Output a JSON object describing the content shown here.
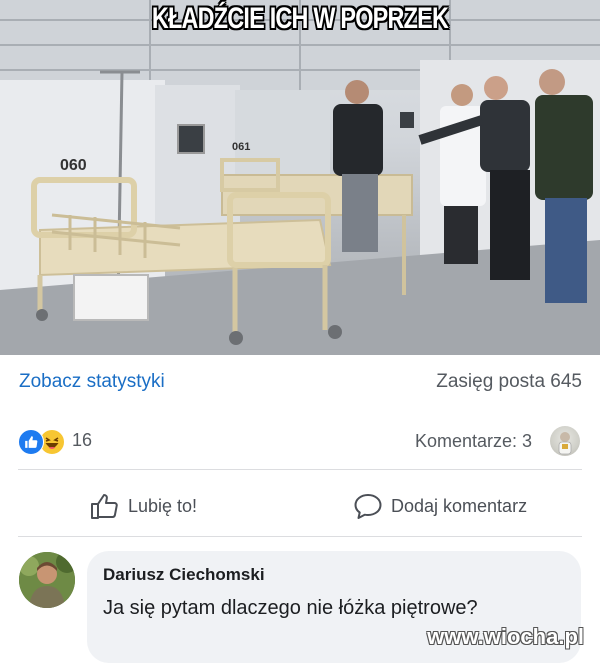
{
  "photo": {
    "caption": "KŁADŹCIE ICH W POPRZEK",
    "bed_number_left": "060",
    "bed_number_right": "061"
  },
  "stats": {
    "see_stats_label": "Zobacz statystyki",
    "reach_label": "Zasięg posta 645"
  },
  "reactions": {
    "icons": [
      "like-icon",
      "haha-icon"
    ],
    "count": "16",
    "comments_label": "Komentarze: 3"
  },
  "actions": {
    "like_label": "Lubię to!",
    "comment_label": "Dodaj komentarz"
  },
  "comment": {
    "author": "Dariusz Ciechomski",
    "text": "Ja się pytam dlaczego nie łóżka piętrowe?"
  },
  "watermark": "www.wiocha.pl",
  "colors": {
    "link": "#1a6ec5",
    "like_reaction": "#1e7bf0",
    "haha_reaction": "#f7c632",
    "bubble": "#f0f2f5"
  }
}
